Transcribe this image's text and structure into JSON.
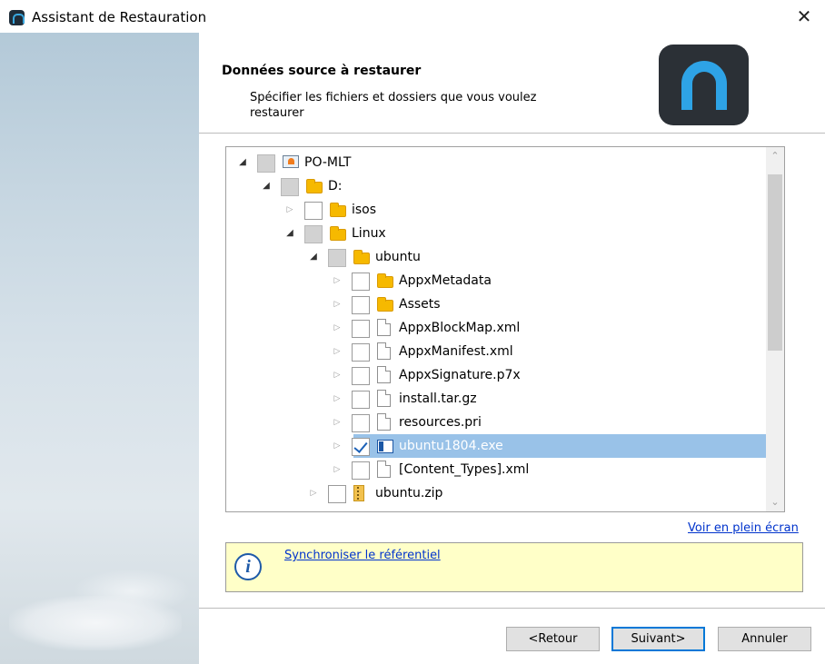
{
  "window": {
    "title": "Assistant de Restauration",
    "close_label": "✕"
  },
  "header": {
    "title": "Données source à restaurer",
    "subtitle": "Spécifier les fichiers et dossiers que vous voulez restaurer"
  },
  "tree": {
    "items": [
      {
        "label": "PO-MLT",
        "icon": "computer-icon",
        "state": "partial",
        "expanded": true
      },
      {
        "label": "D:",
        "icon": "folder-icon",
        "state": "partial",
        "expanded": true
      },
      {
        "label": "isos",
        "icon": "folder-icon",
        "state": "unchecked",
        "expanded": false
      },
      {
        "label": "Linux",
        "icon": "folder-icon",
        "state": "partial",
        "expanded": true
      },
      {
        "label": "ubuntu",
        "icon": "folder-icon",
        "state": "partial",
        "expanded": true
      },
      {
        "label": "AppxMetadata",
        "icon": "folder-icon",
        "state": "unchecked",
        "expanded": false
      },
      {
        "label": "Assets",
        "icon": "folder-icon",
        "state": "unchecked",
        "expanded": false
      },
      {
        "label": "AppxBlockMap.xml",
        "icon": "file-icon",
        "state": "unchecked",
        "expanded": false
      },
      {
        "label": "AppxManifest.xml",
        "icon": "file-icon",
        "state": "unchecked",
        "expanded": false
      },
      {
        "label": "AppxSignature.p7x",
        "icon": "file-icon",
        "state": "unchecked",
        "expanded": false
      },
      {
        "label": "install.tar.gz",
        "icon": "file-icon",
        "state": "unchecked",
        "expanded": false
      },
      {
        "label": "resources.pri",
        "icon": "file-icon",
        "state": "unchecked",
        "expanded": false
      },
      {
        "label": "ubuntu1804.exe",
        "icon": "exe-icon",
        "state": "checked",
        "expanded": false,
        "selected": true
      },
      {
        "label": "[Content_Types].xml",
        "icon": "file-icon",
        "state": "unchecked",
        "expanded": false
      },
      {
        "label": "ubuntu.zip",
        "icon": "zip-icon",
        "state": "unchecked",
        "expanded": false
      }
    ]
  },
  "links": {
    "fullscreen": "Voir en plein écran"
  },
  "info": {
    "link": "Synchroniser le référentiel",
    "icon": "info-icon"
  },
  "buttons": {
    "back": "<Retour",
    "next": "Suivant>",
    "cancel": "Annuler"
  },
  "colors": {
    "selection": "#99c2e8",
    "info_bg": "#ffffc8",
    "link": "#0033cc",
    "primary_border": "#0078d7"
  }
}
